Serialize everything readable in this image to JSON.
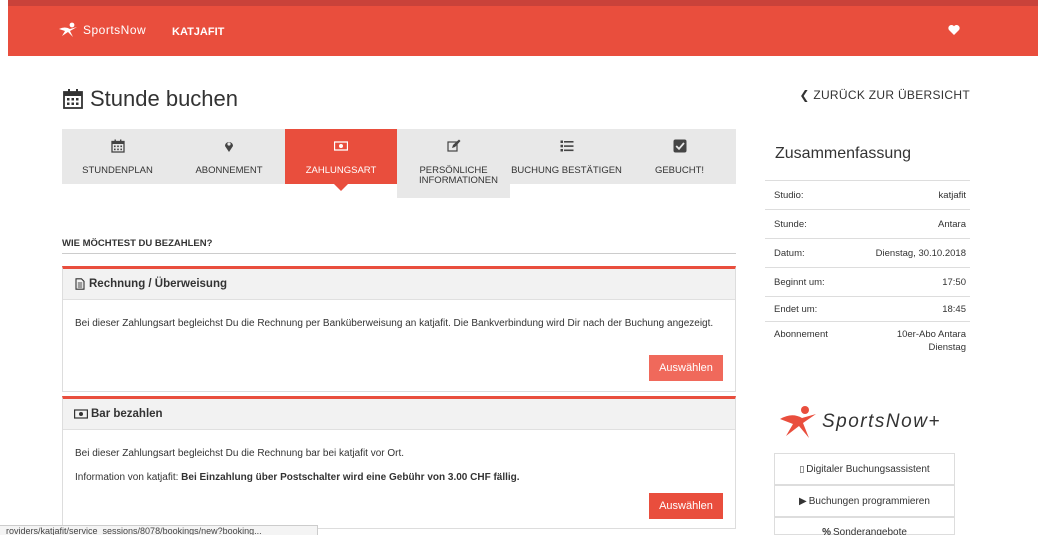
{
  "header": {
    "logo_text": "SportsNow",
    "studio": "KATJAFIT",
    "colors": {
      "brand": "#e94e3d"
    }
  },
  "page": {
    "title": "Stunde buchen",
    "back_link": "ZURÜCK ZUR ÜBERSICHT"
  },
  "steps": [
    {
      "label": "STUNDENPLAN",
      "icon": "calendar-icon",
      "active": false
    },
    {
      "label": "ABONNEMENT",
      "icon": "map-pin-icon",
      "active": false
    },
    {
      "label": "ZAHLUNGSART",
      "icon": "money-icon",
      "active": true
    },
    {
      "label": "PERSÖNLICHE INFORMATIONEN",
      "icon": "edit-icon",
      "active": false
    },
    {
      "label": "BUCHUNG BESTÄTIGEN",
      "icon": "list-icon",
      "active": false
    },
    {
      "label": "GEBUCHT!",
      "icon": "check-square-icon",
      "active": false
    }
  ],
  "payment": {
    "heading": "WIE MÖCHTEST DU BEZAHLEN?",
    "options": [
      {
        "title": "Rechnung / Überweisung",
        "icon": "document-icon",
        "description": "Bei dieser Zahlungsart begleichst Du die Rechnung per Banküberweisung an katjafit. Die Bankverbindung wird Dir nach der Buchung angezeigt.",
        "button": "Auswählen"
      },
      {
        "title": "Bar bezahlen",
        "icon": "money-icon",
        "description": "Bei dieser Zahlungsart begleichst Du die Rechnung bar bei katjafit vor Ort.",
        "info_prefix": "Information von katjafit:",
        "info_bold": "Bei Einzahlung über Postschalter wird eine Gebühr von 3.00 CHF fällig.",
        "button": "Auswählen"
      }
    ]
  },
  "summary": {
    "title": "Zusammenfassung",
    "rows": [
      {
        "label": "Studio:",
        "value": "katjafit"
      },
      {
        "label": "Stunde:",
        "value": "Antara"
      },
      {
        "label": "Datum:",
        "value": "Dienstag, 30.10.2018"
      },
      {
        "label": "Beginnt um:",
        "value": "17:50"
      },
      {
        "label": "Endet um:",
        "value": "18:45"
      },
      {
        "label": "Abonnement",
        "value": "10er-Abo Antara Dienstag"
      }
    ]
  },
  "sidebar": {
    "brand": "SportsNow+",
    "buttons": [
      {
        "label": "Digitaler Buchungsassistent",
        "icon": "mobile-icon"
      },
      {
        "label": "Buchungen programmieren",
        "icon": "play-icon"
      },
      {
        "label": "Sonderangebote",
        "icon": "percent-icon"
      }
    ]
  },
  "status_bar": {
    "url": "roviders/katjafit/service_sessions/8078/bookings/new?booking..."
  }
}
